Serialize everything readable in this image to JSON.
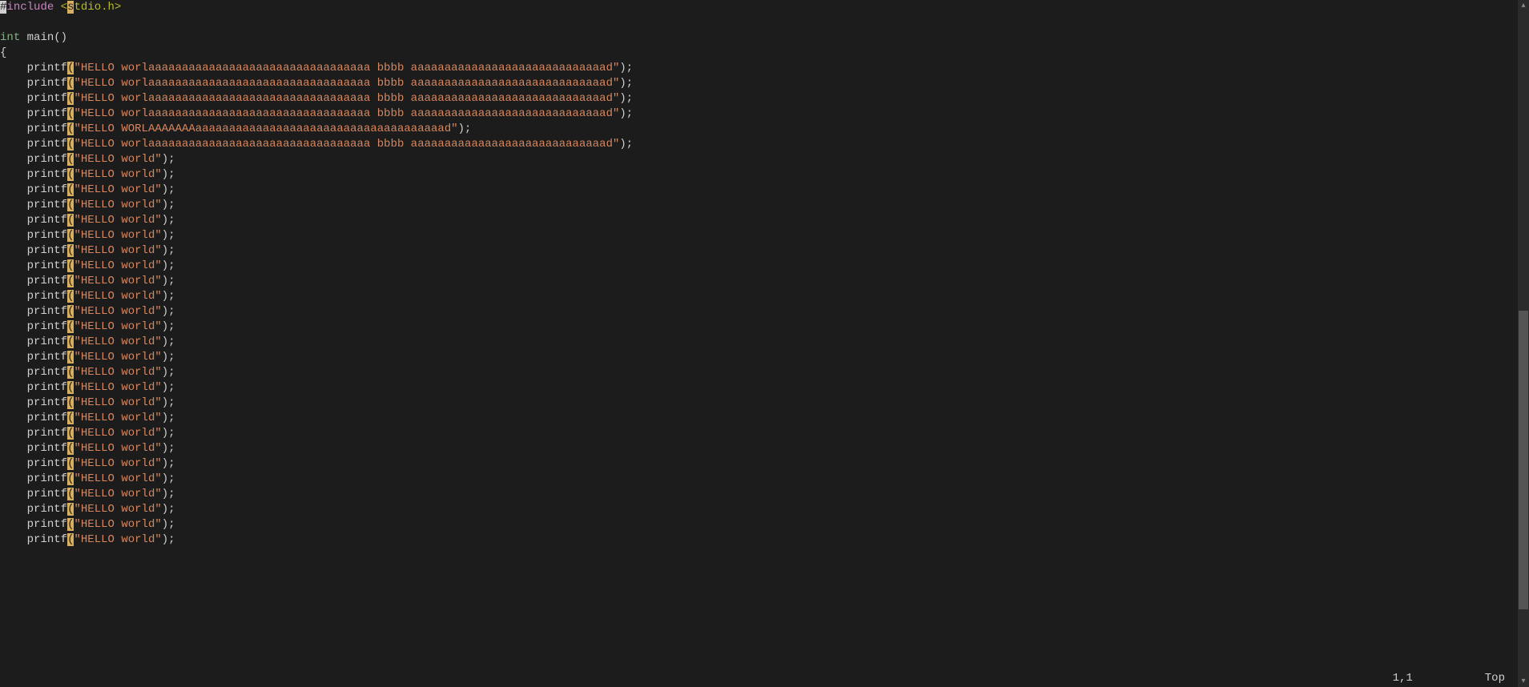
{
  "status": {
    "pos": "1,1",
    "scroll": "Top"
  },
  "cursor": {
    "line": 0,
    "col": 0
  },
  "highlightCol": 10,
  "colors": {
    "bg": "#1c1c1c",
    "string": "#d7875f",
    "type": "#87af87",
    "preproc": "#c586c0",
    "path": "#b8bb26",
    "hl": "#d7af5f"
  },
  "lines": [
    [
      {
        "t": "#",
        "c": "tok-preproc-hash"
      },
      {
        "t": "include ",
        "c": "tok-preproc"
      },
      {
        "t": "<stdio.h>",
        "c": "tok-include-path"
      }
    ],
    [],
    [
      {
        "t": "int",
        "c": "tok-type"
      },
      {
        "t": " main()",
        "c": "tok-ident"
      }
    ],
    [
      {
        "t": "{",
        "c": "tok-punct"
      }
    ],
    [
      {
        "t": "    printf",
        "c": "tok-func"
      },
      {
        "t": "(",
        "c": "tok-punct"
      },
      {
        "t": "\"HELLO worlaaaaaaaaaaaaaaaaaaaaaaaaaaaaaaaaa bbbb aaaaaaaaaaaaaaaaaaaaaaaaaaaaad\"",
        "c": "tok-string"
      },
      {
        "t": ");",
        "c": "tok-punct"
      }
    ],
    [
      {
        "t": "    printf",
        "c": "tok-func"
      },
      {
        "t": "(",
        "c": "tok-punct"
      },
      {
        "t": "\"HELLO worlaaaaaaaaaaaaaaaaaaaaaaaaaaaaaaaaa bbbb aaaaaaaaaaaaaaaaaaaaaaaaaaaaad\"",
        "c": "tok-string"
      },
      {
        "t": ");",
        "c": "tok-punct"
      }
    ],
    [
      {
        "t": "    printf",
        "c": "tok-func"
      },
      {
        "t": "(",
        "c": "tok-punct"
      },
      {
        "t": "\"HELLO worlaaaaaaaaaaaaaaaaaaaaaaaaaaaaaaaaa bbbb aaaaaaaaaaaaaaaaaaaaaaaaaaaaad\"",
        "c": "tok-string"
      },
      {
        "t": ");",
        "c": "tok-punct"
      }
    ],
    [
      {
        "t": "    printf",
        "c": "tok-func"
      },
      {
        "t": "(",
        "c": "tok-punct"
      },
      {
        "t": "\"HELLO worlaaaaaaaaaaaaaaaaaaaaaaaaaaaaaaaaa bbbb aaaaaaaaaaaaaaaaaaaaaaaaaaaaad\"",
        "c": "tok-string"
      },
      {
        "t": ");",
        "c": "tok-punct"
      }
    ],
    [
      {
        "t": "    printf",
        "c": "tok-func"
      },
      {
        "t": "(",
        "c": "tok-punct"
      },
      {
        "t": "\"HELLO WORLAAAAAAAaaaaaaaaaaaaaaaaaaaaaaaaaaaaaaaaaaaaad\"",
        "c": "tok-string"
      },
      {
        "t": ");",
        "c": "tok-punct"
      }
    ],
    [
      {
        "t": "    printf",
        "c": "tok-func"
      },
      {
        "t": "(",
        "c": "tok-punct"
      },
      {
        "t": "\"HELLO worlaaaaaaaaaaaaaaaaaaaaaaaaaaaaaaaaa bbbb aaaaaaaaaaaaaaaaaaaaaaaaaaaaad\"",
        "c": "tok-string"
      },
      {
        "t": ");",
        "c": "tok-punct"
      }
    ],
    [
      {
        "t": "    printf",
        "c": "tok-func"
      },
      {
        "t": "(",
        "c": "tok-punct"
      },
      {
        "t": "\"HELLO world\"",
        "c": "tok-string"
      },
      {
        "t": ");",
        "c": "tok-punct"
      }
    ],
    [
      {
        "t": "    printf",
        "c": "tok-func"
      },
      {
        "t": "(",
        "c": "tok-punct"
      },
      {
        "t": "\"HELLO world\"",
        "c": "tok-string"
      },
      {
        "t": ");",
        "c": "tok-punct"
      }
    ],
    [
      {
        "t": "    printf",
        "c": "tok-func"
      },
      {
        "t": "(",
        "c": "tok-punct"
      },
      {
        "t": "\"HELLO world\"",
        "c": "tok-string"
      },
      {
        "t": ");",
        "c": "tok-punct"
      }
    ],
    [
      {
        "t": "    printf",
        "c": "tok-func"
      },
      {
        "t": "(",
        "c": "tok-punct"
      },
      {
        "t": "\"HELLO world\"",
        "c": "tok-string"
      },
      {
        "t": ");",
        "c": "tok-punct"
      }
    ],
    [
      {
        "t": "    printf",
        "c": "tok-func"
      },
      {
        "t": "(",
        "c": "tok-punct"
      },
      {
        "t": "\"HELLO world\"",
        "c": "tok-string"
      },
      {
        "t": ");",
        "c": "tok-punct"
      }
    ],
    [
      {
        "t": "    printf",
        "c": "tok-func"
      },
      {
        "t": "(",
        "c": "tok-punct"
      },
      {
        "t": "\"HELLO world\"",
        "c": "tok-string"
      },
      {
        "t": ");",
        "c": "tok-punct"
      }
    ],
    [
      {
        "t": "    printf",
        "c": "tok-func"
      },
      {
        "t": "(",
        "c": "tok-punct"
      },
      {
        "t": "\"HELLO world\"",
        "c": "tok-string"
      },
      {
        "t": ");",
        "c": "tok-punct"
      }
    ],
    [
      {
        "t": "    printf",
        "c": "tok-func"
      },
      {
        "t": "(",
        "c": "tok-punct"
      },
      {
        "t": "\"HELLO world\"",
        "c": "tok-string"
      },
      {
        "t": ");",
        "c": "tok-punct"
      }
    ],
    [
      {
        "t": "    printf",
        "c": "tok-func"
      },
      {
        "t": "(",
        "c": "tok-punct"
      },
      {
        "t": "\"HELLO world\"",
        "c": "tok-string"
      },
      {
        "t": ");",
        "c": "tok-punct"
      }
    ],
    [
      {
        "t": "    printf",
        "c": "tok-func"
      },
      {
        "t": "(",
        "c": "tok-punct"
      },
      {
        "t": "\"HELLO world\"",
        "c": "tok-string"
      },
      {
        "t": ");",
        "c": "tok-punct"
      }
    ],
    [
      {
        "t": "    printf",
        "c": "tok-func"
      },
      {
        "t": "(",
        "c": "tok-punct"
      },
      {
        "t": "\"HELLO world\"",
        "c": "tok-string"
      },
      {
        "t": ");",
        "c": "tok-punct"
      }
    ],
    [
      {
        "t": "    printf",
        "c": "tok-func"
      },
      {
        "t": "(",
        "c": "tok-punct"
      },
      {
        "t": "\"HELLO world\"",
        "c": "tok-string"
      },
      {
        "t": ");",
        "c": "tok-punct"
      }
    ],
    [
      {
        "t": "    printf",
        "c": "tok-func"
      },
      {
        "t": "(",
        "c": "tok-punct"
      },
      {
        "t": "\"HELLO world\"",
        "c": "tok-string"
      },
      {
        "t": ");",
        "c": "tok-punct"
      }
    ],
    [
      {
        "t": "    printf",
        "c": "tok-func"
      },
      {
        "t": "(",
        "c": "tok-punct"
      },
      {
        "t": "\"HELLO world\"",
        "c": "tok-string"
      },
      {
        "t": ");",
        "c": "tok-punct"
      }
    ],
    [
      {
        "t": "    printf",
        "c": "tok-func"
      },
      {
        "t": "(",
        "c": "tok-punct"
      },
      {
        "t": "\"HELLO world\"",
        "c": "tok-string"
      },
      {
        "t": ");",
        "c": "tok-punct"
      }
    ],
    [
      {
        "t": "    printf",
        "c": "tok-func"
      },
      {
        "t": "(",
        "c": "tok-punct"
      },
      {
        "t": "\"HELLO world\"",
        "c": "tok-string"
      },
      {
        "t": ");",
        "c": "tok-punct"
      }
    ],
    [
      {
        "t": "    printf",
        "c": "tok-func"
      },
      {
        "t": "(",
        "c": "tok-punct"
      },
      {
        "t": "\"HELLO world\"",
        "c": "tok-string"
      },
      {
        "t": ");",
        "c": "tok-punct"
      }
    ],
    [
      {
        "t": "    printf",
        "c": "tok-func"
      },
      {
        "t": "(",
        "c": "tok-punct"
      },
      {
        "t": "\"HELLO world\"",
        "c": "tok-string"
      },
      {
        "t": ");",
        "c": "tok-punct"
      }
    ],
    [
      {
        "t": "    printf",
        "c": "tok-func"
      },
      {
        "t": "(",
        "c": "tok-punct"
      },
      {
        "t": "\"HELLO world\"",
        "c": "tok-string"
      },
      {
        "t": ");",
        "c": "tok-punct"
      }
    ],
    [
      {
        "t": "    printf",
        "c": "tok-func"
      },
      {
        "t": "(",
        "c": "tok-punct"
      },
      {
        "t": "\"HELLO world\"",
        "c": "tok-string"
      },
      {
        "t": ");",
        "c": "tok-punct"
      }
    ],
    [
      {
        "t": "    printf",
        "c": "tok-func"
      },
      {
        "t": "(",
        "c": "tok-punct"
      },
      {
        "t": "\"HELLO world\"",
        "c": "tok-string"
      },
      {
        "t": ");",
        "c": "tok-punct"
      }
    ],
    [
      {
        "t": "    printf",
        "c": "tok-func"
      },
      {
        "t": "(",
        "c": "tok-punct"
      },
      {
        "t": "\"HELLO world\"",
        "c": "tok-string"
      },
      {
        "t": ");",
        "c": "tok-punct"
      }
    ],
    [
      {
        "t": "    printf",
        "c": "tok-func"
      },
      {
        "t": "(",
        "c": "tok-punct"
      },
      {
        "t": "\"HELLO world\"",
        "c": "tok-string"
      },
      {
        "t": ");",
        "c": "tok-punct"
      }
    ],
    [
      {
        "t": "    printf",
        "c": "tok-func"
      },
      {
        "t": "(",
        "c": "tok-punct"
      },
      {
        "t": "\"HELLO world\"",
        "c": "tok-string"
      },
      {
        "t": ");",
        "c": "tok-punct"
      }
    ],
    [
      {
        "t": "    printf",
        "c": "tok-func"
      },
      {
        "t": "(",
        "c": "tok-punct"
      },
      {
        "t": "\"HELLO world\"",
        "c": "tok-string"
      },
      {
        "t": ");",
        "c": "tok-punct"
      }
    ],
    [
      {
        "t": "    printf",
        "c": "tok-func"
      },
      {
        "t": "(",
        "c": "tok-punct"
      },
      {
        "t": "\"HELLO world\"",
        "c": "tok-string"
      },
      {
        "t": ");",
        "c": "tok-punct"
      }
    ]
  ]
}
